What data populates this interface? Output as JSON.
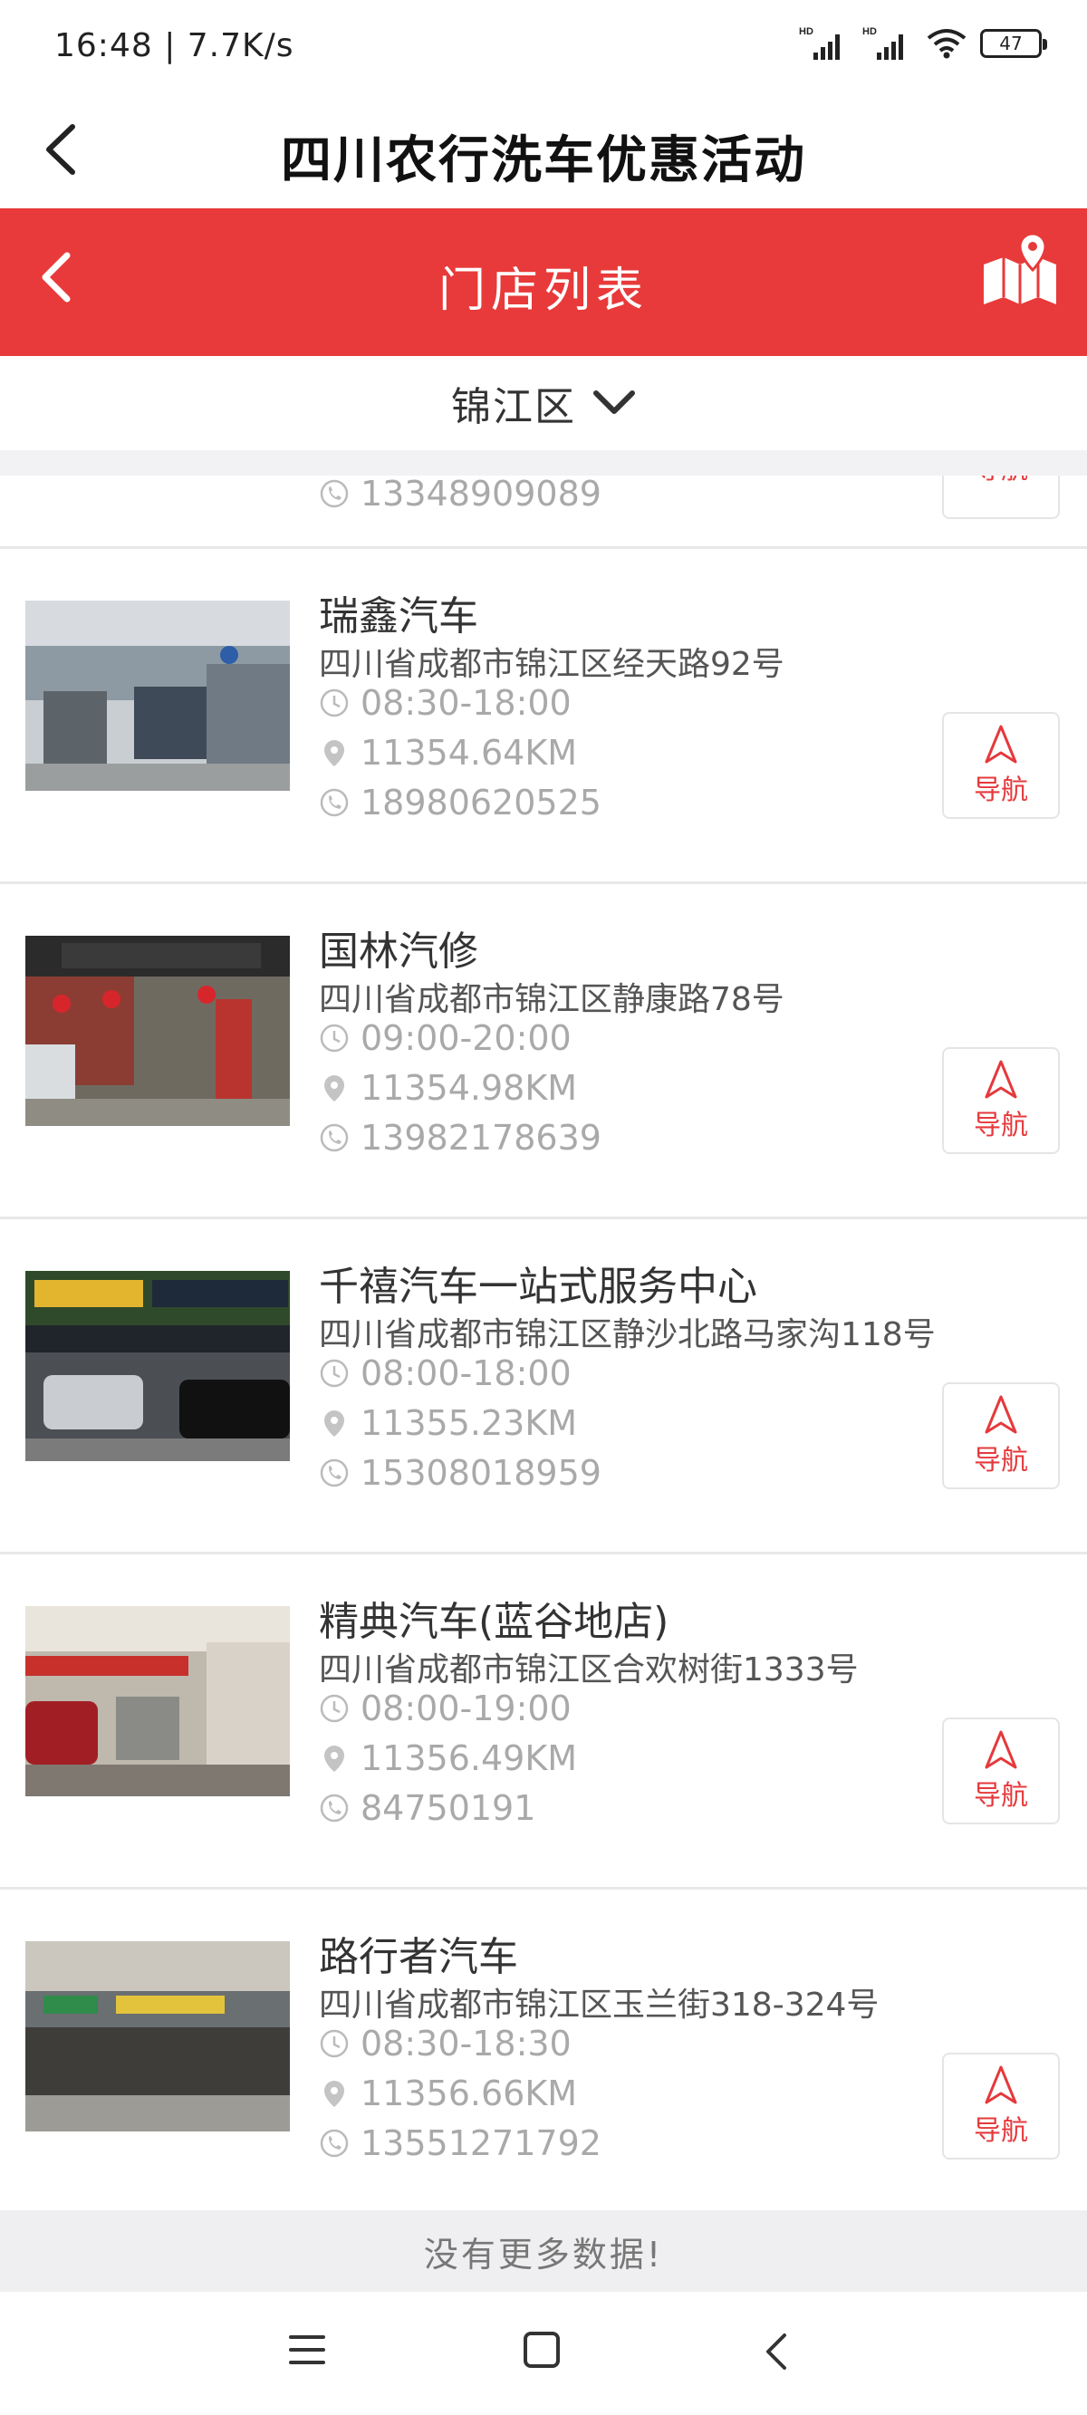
{
  "status_bar": {
    "time": "16:48 | 7.7K/s",
    "battery": "47"
  },
  "app_bar": {
    "title": "四川农行洗车优惠活动"
  },
  "header": {
    "title": "门店列表",
    "accent_color": "#e83a3a"
  },
  "filter": {
    "district": "锦江区"
  },
  "partial_item": {
    "phone": "13348909089",
    "nav_label": "导航"
  },
  "stores": [
    {
      "name": "瑞鑫汽车",
      "address": "四川省成都市锦江区经天路92号",
      "hours": "08:30-18:00",
      "distance": "11354.64KM",
      "phone": "18980620525",
      "nav_label": "导航"
    },
    {
      "name": "国林汽修",
      "address": "四川省成都市锦江区静康路78号",
      "hours": "09:00-20:00",
      "distance": "11354.98KM",
      "phone": "13982178639",
      "nav_label": "导航"
    },
    {
      "name": "千禧汽车一站式服务中心",
      "address": "四川省成都市锦江区静沙北路马家沟118号",
      "hours": "08:00-18:00",
      "distance": "11355.23KM",
      "phone": "15308018959",
      "nav_label": "导航"
    },
    {
      "name": "精典汽车(蓝谷地店)",
      "address": "四川省成都市锦江区合欢树街1333号",
      "hours": "08:00-19:00",
      "distance": "11356.49KM",
      "phone": "84750191",
      "nav_label": "导航"
    },
    {
      "name": "路行者汽车",
      "address": "四川省成都市锦江区玉兰街318-324号",
      "hours": "08:30-18:30",
      "distance": "11356.66KM",
      "phone": "13551271792",
      "nav_label": "导航"
    }
  ],
  "footer": {
    "no_more": "没有更多数据!"
  }
}
